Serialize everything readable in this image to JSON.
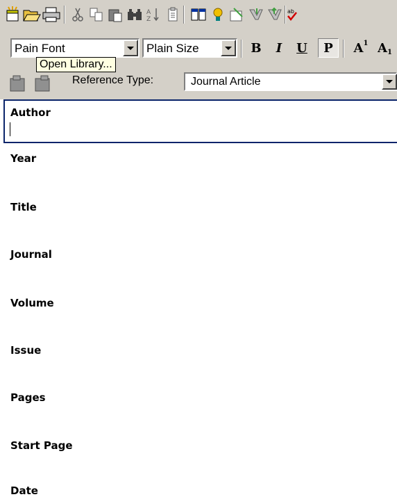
{
  "toolbar": {
    "icons": [
      "new-library-icon",
      "open-folder-icon",
      "print-icon",
      "cut-icon",
      "copy-icon",
      "paste-icon",
      "find-icon",
      "sort-icon",
      "clipboard-icon",
      "show-all-icon",
      "online-search-icon",
      "import-icon",
      "export-icon",
      "cite-icon",
      "spell-check-icon"
    ]
  },
  "format_bar": {
    "font": "Pain Font",
    "size": "Plain Size",
    "bold": "B",
    "italic": "I",
    "underline": "U",
    "plain": "P",
    "superscript_base": "A",
    "superscript_exp": "1",
    "subscript_base": "A",
    "subscript_exp": "1"
  },
  "tooltip": "Open Library...",
  "reference": {
    "type_label": "Reference Type:",
    "type_value": "Journal Article"
  },
  "fields": [
    "Author",
    "Year",
    "Title",
    "Journal",
    "Volume",
    "Issue",
    "Pages",
    "Start Page",
    "Date"
  ],
  "colors": {
    "chrome": "#d4d0c8",
    "focus_border": "#0a246a",
    "tooltip_bg": "#ffffe1"
  }
}
